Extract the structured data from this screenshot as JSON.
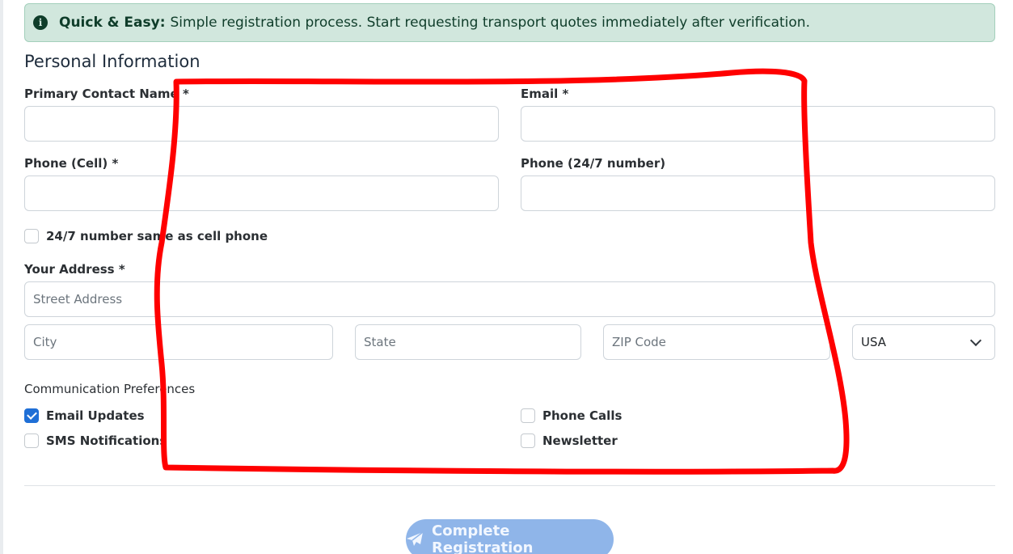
{
  "alert": {
    "strong": "Quick & Easy:",
    "text": "Simple registration process. Start requesting transport quotes immediately after verification."
  },
  "section_title": "Personal Information",
  "fields": {
    "primary_contact_label": "Primary Contact Name *",
    "email_label": "Email *",
    "phone_cell_label": "Phone (Cell) *",
    "phone_247_label": "Phone (24/7 number)",
    "same_as_cell_label": "24/7 number same as cell phone",
    "address_label": "Your Address *",
    "street_placeholder": "Street Address",
    "city_placeholder": "City",
    "state_placeholder": "State",
    "zip_placeholder": "ZIP Code",
    "country_value": "USA"
  },
  "preferences": {
    "title": "Communication Preferences",
    "email_updates": "Email Updates",
    "sms": "SMS Notifications",
    "phone_calls": "Phone Calls",
    "newsletter": "Newsletter"
  },
  "submit_label": "Complete Registration",
  "colors": {
    "alert_bg": "#d1e7dd",
    "accent": "#1f6fd6",
    "button": "#8fb5e9",
    "scribble": "#ff0000"
  }
}
